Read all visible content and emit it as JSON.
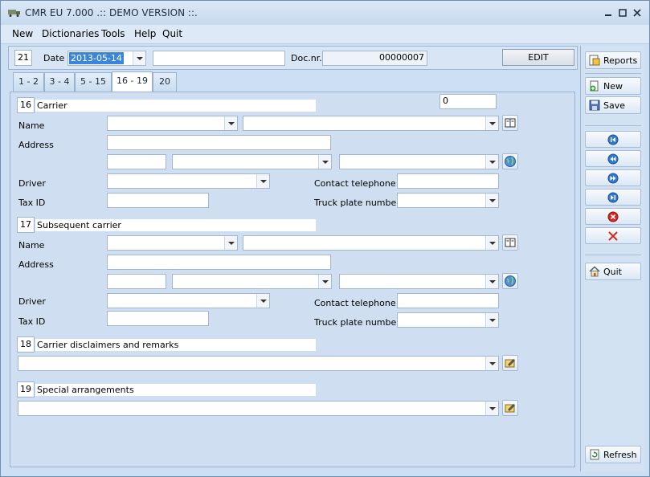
{
  "window": {
    "title": "CMR EU 7.000 .:: DEMO VERSION ::."
  },
  "menu": [
    "New",
    "Dictionaries",
    "Tools",
    "Help",
    "Quit"
  ],
  "header": {
    "num": "21",
    "date_label": "Date",
    "date_value": "2013-05-14",
    "extra_value": "",
    "docnr_label": "Doc.nr.",
    "docnr_value": "00000007",
    "edit_label": "EDIT"
  },
  "tabs": [
    "1 - 2",
    "3 - 4",
    "5 - 15",
    "16 - 19",
    "20"
  ],
  "active_tab": "16 - 19",
  "carrier": {
    "num": "16",
    "title": "Carrier",
    "count_value": "0",
    "name_label": "Name",
    "address_label": "Address",
    "driver_label": "Driver",
    "contact_label": "Contact telephone",
    "taxid_label": "Tax ID",
    "truck_label": "Truck plate number"
  },
  "subsequent": {
    "num": "17",
    "title": "Subsequent carrier",
    "name_label": "Name",
    "address_label": "Address",
    "driver_label": "Driver",
    "contact_label": "Contact telephone",
    "taxid_label": "Tax ID",
    "truck_label": "Truck plate number"
  },
  "remarks": {
    "num": "18",
    "title": "Carrier disclaimers and remarks"
  },
  "special": {
    "num": "19",
    "title": "Special arrangements"
  },
  "sidebar": {
    "reports": "Reports",
    "new": "New",
    "save": "Save",
    "quit": "Quit",
    "refresh": "Refresh"
  },
  "colors": {
    "accent": "#3b86d8",
    "panel": "#cfdff1",
    "delete": "#d9261c"
  }
}
